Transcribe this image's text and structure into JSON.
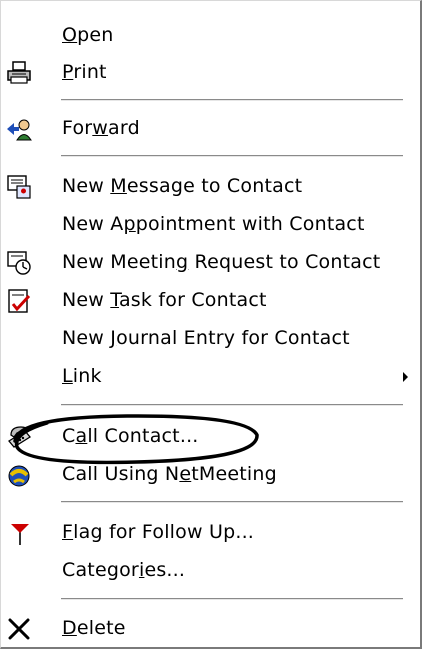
{
  "menu": {
    "items": [
      {
        "id": "open",
        "pre": "",
        "u": "O",
        "post": "pen",
        "icon": "none"
      },
      {
        "id": "print",
        "pre": "",
        "u": "P",
        "post": "rint",
        "icon": "printer-icon"
      },
      {
        "id": "forward",
        "pre": "For",
        "u": "w",
        "post": "ard",
        "icon": "forward-contact-icon"
      },
      {
        "id": "new-message",
        "pre": "New ",
        "u": "M",
        "post": "essage to Contact",
        "icon": "new-message-icon"
      },
      {
        "id": "new-appointment",
        "pre": "New A",
        "u": "p",
        "post": "pointment with Contact",
        "icon": "none"
      },
      {
        "id": "new-meeting",
        "pre": "New Meetin",
        "u": "g",
        "post": " Request to Contact",
        "icon": "meeting-request-icon"
      },
      {
        "id": "new-task",
        "pre": "New ",
        "u": "T",
        "post": "ask for Contact",
        "icon": "task-icon"
      },
      {
        "id": "new-journal",
        "pre": "New ",
        "u": "J",
        "post": "ournal Entry for Contact",
        "icon": "none"
      },
      {
        "id": "link",
        "pre": "",
        "u": "L",
        "post": "ink",
        "icon": "none",
        "submenu": true
      },
      {
        "id": "call-contact",
        "pre": "C",
        "u": "a",
        "post": "ll Contact...",
        "icon": "phone-icon"
      },
      {
        "id": "call-netmeeting",
        "pre": "Call Using N",
        "u": "e",
        "post": "tMeeting",
        "icon": "netmeeting-icon"
      },
      {
        "id": "flag",
        "pre": "",
        "u": "F",
        "post": "lag for Follow Up...",
        "icon": "flag-icon"
      },
      {
        "id": "categories",
        "pre": "Categor",
        "u": "i",
        "post": "es...",
        "icon": "none"
      },
      {
        "id": "delete",
        "pre": "",
        "u": "D",
        "post": "elete",
        "icon": "delete-icon"
      }
    ]
  },
  "colors": {
    "flag": "#cc0000",
    "check": "#cc0000",
    "netmeeting_blue": "#1f4fb8",
    "netmeeting_yellow": "#e8c000",
    "annotation": "#000000"
  }
}
